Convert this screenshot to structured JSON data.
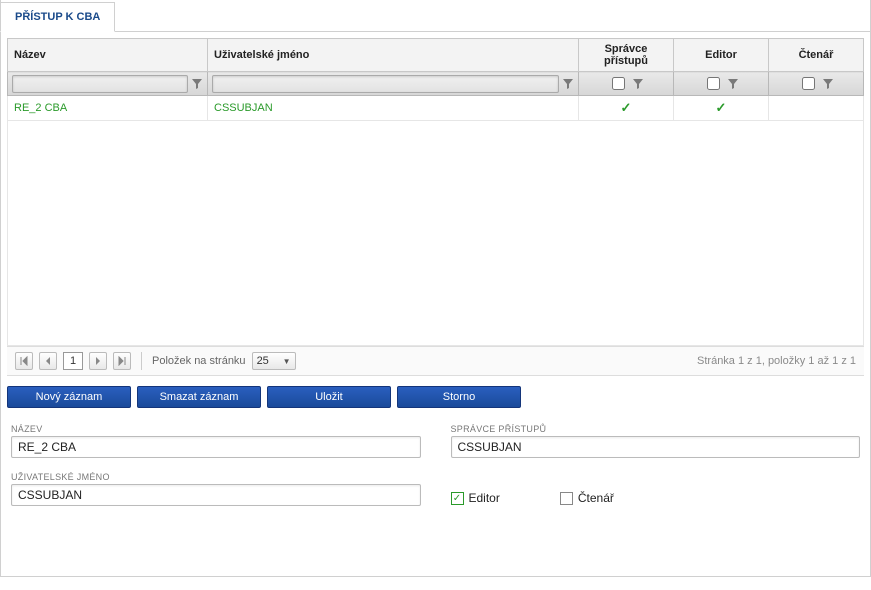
{
  "tab": {
    "title": "PŘÍSTUP K CBA"
  },
  "grid": {
    "columns": {
      "name": "Název",
      "username": "Uživatelské jméno",
      "accessManager": "Správce přístupů",
      "editor": "Editor",
      "reader": "Čtenář"
    },
    "rows": [
      {
        "name": "RE_2 CBA",
        "username": "CSSUBJAN",
        "accessManager": true,
        "editor": true,
        "reader": false
      }
    ]
  },
  "pager": {
    "page": "1",
    "itemsPerPageLabel": "Položek na stránku",
    "pageSize": "25",
    "info": "Stránka 1 z 1, položky 1 až 1 z 1"
  },
  "actions": {
    "new": "Nový záznam",
    "delete": "Smazat záznam",
    "save": "Uložit",
    "cancel": "Storno"
  },
  "form": {
    "nameLabel": "NÁZEV",
    "nameValue": "RE_2 CBA",
    "accessManagerLabel": "SPRÁVCE PŘÍSTUPŮ",
    "accessManagerValue": "CSSUBJAN",
    "usernameLabel": "UŽIVATELSKÉ JMÉNO",
    "usernameValue": "CSSUBJAN",
    "editorLabel": "Editor",
    "readerLabel": "Čtenář",
    "editorChecked": true,
    "readerChecked": false
  }
}
